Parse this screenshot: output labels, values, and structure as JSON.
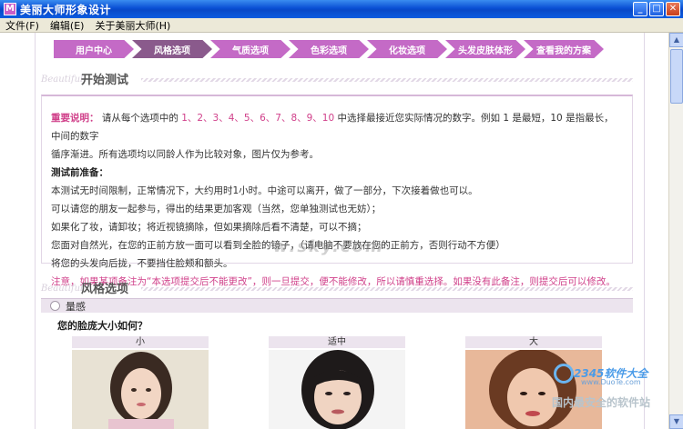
{
  "window": {
    "title": "美丽大师形象设计",
    "icon_letter": "M"
  },
  "menu": {
    "items": [
      "文件(F)",
      "编辑(E)",
      "关于美丽大师(H)"
    ]
  },
  "steps": [
    "用户中心",
    "风格选项",
    "气质选项",
    "色彩选项",
    "化妆选项",
    "头发皮肤体形",
    "查看我的方案"
  ],
  "intro": {
    "bg_word": "Beautiful",
    "heading": "开始测试",
    "important_label": "重要说明：",
    "line1_a": "请从每个选项中的",
    "nums": "1、2、3、4、5、6、7、8、9、10",
    "line1_b": "中选择最接近您实际情况的数字。例如 1 是最短，10 是指最长，中间的数字",
    "line2": "循序渐进。所有选项均以同龄人作为比较对象，图片仅为参考。",
    "prep_title": "测试前准备：",
    "prep_lines": [
      "本测试无时间限制，正常情况下，大约用时1小时。中途可以离开，做了一部分，下次接着做也可以。",
      "可以请您的朋友一起参与，得出的结果更加客观（当然，您单独测试也无妨）；",
      "如果化了妆，请卸妆；将近视镜摘除，但如果摘除后看不清楚，可以不摘；",
      "您面对自然光，在您的正前方放一面可以看到全脸的镜子，（请电脑不要放在您的正前方，否则行动不方便）",
      "将您的头发向后拢，不要挡住脸颊和额头。"
    ],
    "note": "注意，如果某项备注为“本选项提交后不能更改”，则一旦提交，便不能修改，所以请慎重选择。如果没有此备注，则提交后可以修改。"
  },
  "style": {
    "bg_word": "Beautiful",
    "heading": "风格选项",
    "category": "量感",
    "question": "您的脸庞大小如何？",
    "options": [
      "小",
      "适中",
      "大"
    ]
  },
  "watermark": {
    "main": "w.sky.com",
    "brand": "2345软件大全",
    "site": "www.DuoTe.com",
    "slogan": "国内最安全的软件站"
  },
  "colors": {
    "step_pink": "#c46ac6",
    "step_active": "#8a5a8c",
    "accent_text": "#d0408a",
    "titlebar": "#0a4fd4"
  }
}
